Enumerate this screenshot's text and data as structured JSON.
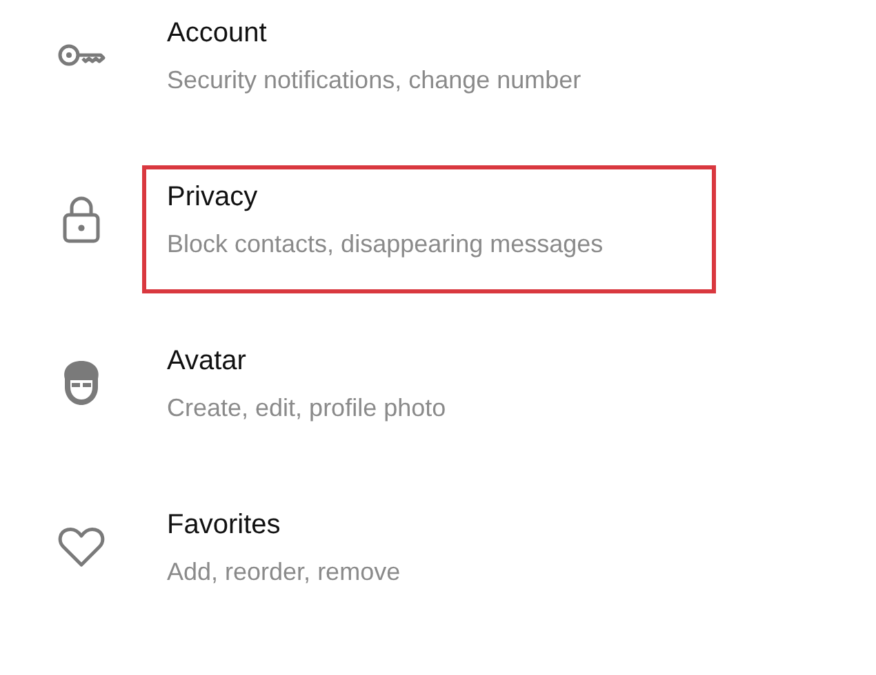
{
  "settings_items": [
    {
      "title": "Account",
      "subtitle": "Security notifications, change number",
      "highlighted": false
    },
    {
      "title": "Privacy",
      "subtitle": "Block contacts, disappearing messages",
      "highlighted": true
    },
    {
      "title": "Avatar",
      "subtitle": "Create, edit, profile photo",
      "highlighted": false
    },
    {
      "title": "Favorites",
      "subtitle": "Add, reorder, remove",
      "highlighted": false
    }
  ]
}
